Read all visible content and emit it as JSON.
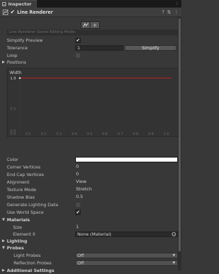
{
  "tab": {
    "label": "Inspector"
  },
  "header": {
    "title": "Line Renderer",
    "enabled": true
  },
  "scene_tools": {
    "label": "Line Renderer Scene Editing Mode:",
    "buttons": [
      "edit-points",
      "add-point"
    ]
  },
  "simplify_preview": {
    "label": "Simplify Preview",
    "checked": true
  },
  "tolerance": {
    "label": "Tolerance",
    "value": "1",
    "button": "Simplify"
  },
  "loop": {
    "label": "Loop",
    "checked": false
  },
  "positions": {
    "label": "Positions"
  },
  "width_curve": {
    "title": "Width",
    "value_label": "1.0",
    "y_ticks": [
      "1.0",
      "0.5",
      "0.0"
    ],
    "x_ticks": [
      "0.0",
      "0.1",
      "0.2",
      "0.3",
      "0.4",
      "0.5",
      "0.6",
      "0.7",
      "0.8",
      "0.9",
      "1.0"
    ],
    "curve_color": "#c22020"
  },
  "fields": {
    "color": {
      "label": "Color",
      "value": "#ffffff"
    },
    "corner_vertices": {
      "label": "Corner Vertices",
      "value": "0"
    },
    "end_cap_vertices": {
      "label": "End Cap Vertices",
      "value": "0"
    },
    "alignment": {
      "label": "Alignment",
      "value": "View"
    },
    "texture_mode": {
      "label": "Texture Mode",
      "value": "Stretch"
    },
    "shadow_bias": {
      "label": "Shadow Bias",
      "value": "0.5"
    },
    "generate_lighting_data": {
      "label": "Generate Lighting Data",
      "checked": false
    },
    "use_world_space": {
      "label": "Use World Space",
      "checked": true
    }
  },
  "materials": {
    "label": "Materials",
    "size_label": "Size",
    "size_value": "1",
    "element_label": "Element 0",
    "element_value": "None (Material)"
  },
  "lighting": {
    "label": "Lighting"
  },
  "probes": {
    "label": "Probes",
    "light_probes_label": "Light Probes",
    "light_probes_value": "Off",
    "reflection_probes_label": "Reflection Probes",
    "reflection_probes_value": "Off"
  },
  "additional_settings": {
    "label": "Additional Settings"
  }
}
